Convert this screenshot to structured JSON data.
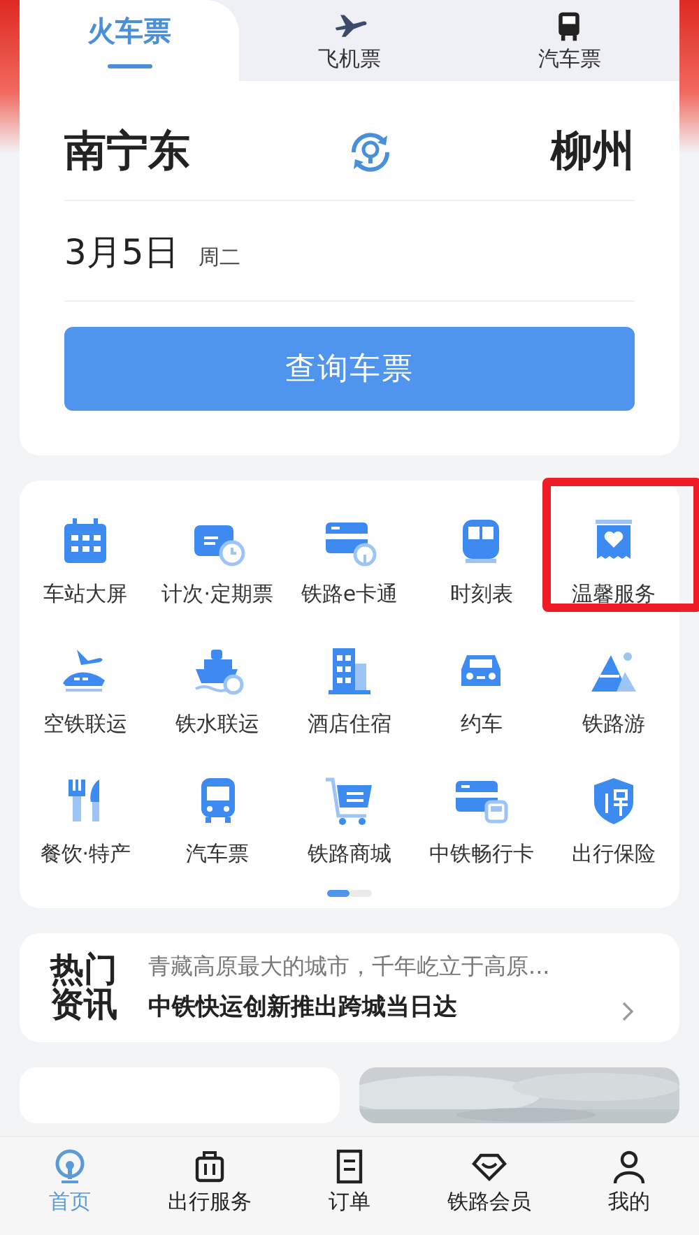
{
  "ticket_tabs": [
    {
      "label": "火车票",
      "selected": true
    },
    {
      "label": "飞机票",
      "selected": false
    },
    {
      "label": "汽车票",
      "selected": false
    }
  ],
  "search": {
    "from": "南宁东",
    "to": "柳州",
    "date": "3月5日",
    "weekday": "周二",
    "button": "查询车票"
  },
  "services": [
    {
      "label": "车站大屏",
      "highlighted": false
    },
    {
      "label": "计次·定期票",
      "highlighted": false
    },
    {
      "label": "铁路e卡通",
      "highlighted": false
    },
    {
      "label": "时刻表",
      "highlighted": false
    },
    {
      "label": "温馨服务",
      "highlighted": true
    },
    {
      "label": "空铁联运",
      "highlighted": false
    },
    {
      "label": "铁水联运",
      "highlighted": false
    },
    {
      "label": "酒店住宿",
      "highlighted": false
    },
    {
      "label": "约车",
      "highlighted": false
    },
    {
      "label": "铁路游",
      "highlighted": false
    },
    {
      "label": "餐饮·特产",
      "highlighted": false
    },
    {
      "label": "汽车票",
      "highlighted": false
    },
    {
      "label": "铁路商城",
      "highlighted": false
    },
    {
      "label": "中铁畅行卡",
      "highlighted": false
    },
    {
      "label": "出行保险",
      "highlighted": false
    }
  ],
  "pager": [
    {
      "selected": true
    },
    {
      "selected": false
    }
  ],
  "news": {
    "title_top": "热门",
    "title_bottom": "资讯",
    "items": [
      "青藏高原最大的城市，千年屹立于高原...",
      "中铁快运创新推出跨城当日达"
    ]
  },
  "bottom_nav": [
    {
      "label": "首页",
      "selected": true
    },
    {
      "label": "出行服务",
      "selected": false
    },
    {
      "label": "订单",
      "selected": false
    },
    {
      "label": "铁路会员",
      "selected": false
    },
    {
      "label": "我的",
      "selected": false
    }
  ]
}
